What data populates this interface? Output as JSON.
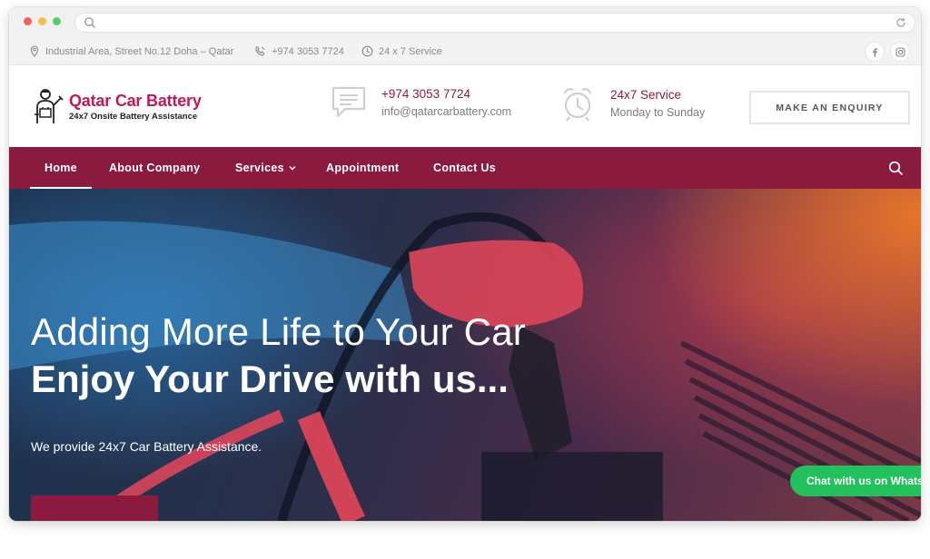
{
  "topbar": {
    "address": "Industrial Area, Street No.12 Doha – Qatar",
    "phone": "+974 3053 7724",
    "service": "24 x 7 Service"
  },
  "header": {
    "logo_title": "Qatar Car Battery",
    "logo_subtitle": "24x7 Onsite Battery Assistance",
    "phone_title": "+974 3053 7724",
    "email": "info@qatarcarbattery.com",
    "service_title": "24x7 Service",
    "service_subtitle": "Monday to Sunday",
    "enquiry_label": "MAKE AN ENQUIRY"
  },
  "nav": {
    "items": [
      "Home",
      "About Company",
      "Services",
      "Appointment",
      "Contact Us"
    ],
    "active": "Home"
  },
  "hero": {
    "line1": "Adding More Life to Your Car",
    "line2": "Enjoy Your Drive with us...",
    "description": "We provide 24x7 Car Battery Assistance."
  },
  "whatsapp": {
    "label": "Chat with us on WhatsApp"
  },
  "colors": {
    "brand": "#8b1a3f",
    "logo": "#c2185b",
    "whatsapp": "#22c15e"
  }
}
